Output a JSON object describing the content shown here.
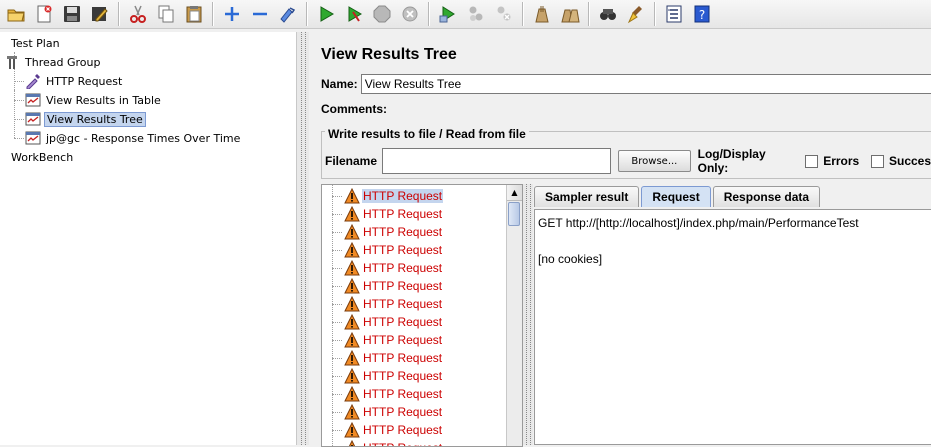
{
  "toolbar": {
    "buttons": [
      "open-icon",
      "new-icon",
      "save-icon",
      "edit-icon",
      "cut-icon",
      "copy-icon",
      "paste-icon",
      "add-icon",
      "remove-icon",
      "toggle-icon",
      "run-icon",
      "run-no-pause-icon",
      "stop-icon",
      "shutdown-icon",
      "remote-start-icon",
      "remote-stop-icon",
      "remote-shutdown-icon",
      "clear-icon",
      "clear-all-icon",
      "search-icon",
      "reset-icon",
      "function-helper-icon",
      "help-icon"
    ]
  },
  "tree": {
    "test_plan": "Test Plan",
    "thread_group": "Thread Group",
    "http_request": "HTTP Request",
    "view_results_table": "View Results in Table",
    "view_results_tree": "View Results Tree",
    "response_times": "jp@gc - Response Times Over Time",
    "workbench": "WorkBench"
  },
  "panel": {
    "title": "View Results Tree",
    "name_label": "Name:",
    "name_value": "View Results Tree",
    "comments_label": "Comments:",
    "file_group_title": "Write results to file / Read from file",
    "filename_label": "Filename",
    "filename_value": "",
    "browse_label": "Browse...",
    "log_display_label": "Log/Display Only:",
    "errors_label": "Errors",
    "success_label": "Succes"
  },
  "results": {
    "items": [
      "HTTP Request",
      "HTTP Request",
      "HTTP Request",
      "HTTP Request",
      "HTTP Request",
      "HTTP Request",
      "HTTP Request",
      "HTTP Request",
      "HTTP Request",
      "HTTP Request",
      "HTTP Request",
      "HTTP Request",
      "HTTP Request",
      "HTTP Request",
      "HTTP Request"
    ]
  },
  "tabs": {
    "sampler_result": "Sampler result",
    "request": "Request",
    "response_data": "Response data"
  },
  "request_content": {
    "line1": "GET http://[http://localhost]/index.php/main/PerformanceTest",
    "line2": "[no cookies]"
  },
  "colors": {
    "error_text": "#cc0000",
    "selection": "#c4d5ee",
    "active_tab": "#d4e2f4"
  }
}
